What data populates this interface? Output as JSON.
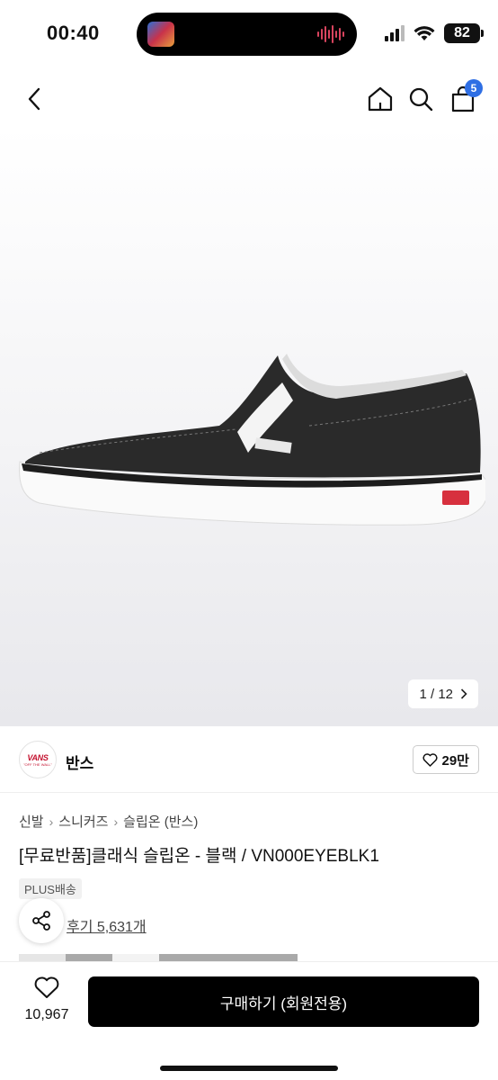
{
  "status_bar": {
    "time": "00:40",
    "battery": "82",
    "icons": [
      "signal-icon",
      "wifi-icon",
      "battery-icon"
    ]
  },
  "nav": {
    "back_icon": "back-chevron-icon",
    "home_icon": "home-icon",
    "search_icon": "search-icon",
    "cart_icon": "cart-icon",
    "cart_count": "5",
    "accent_color": "#2f6fe4"
  },
  "gallery": {
    "counter": "1 / 12",
    "current": 1,
    "total": 12
  },
  "brand": {
    "logo_text": "VANS",
    "logo_sub": "\"OFF THE WALL\"",
    "name": "반스",
    "likes": "29만"
  },
  "product": {
    "breadcrumb": [
      "신발",
      "스니커즈",
      "슬립온 (반스)"
    ],
    "title": "[무료반품]클래식 슬립온 - 블랙 / VN000EYEBLK1",
    "badge": "PLUS배송",
    "reviews": "후기 5,631개"
  },
  "bottom_bar": {
    "wish_count": "10,967",
    "buy_label": "구매하기 (회원전용)"
  }
}
